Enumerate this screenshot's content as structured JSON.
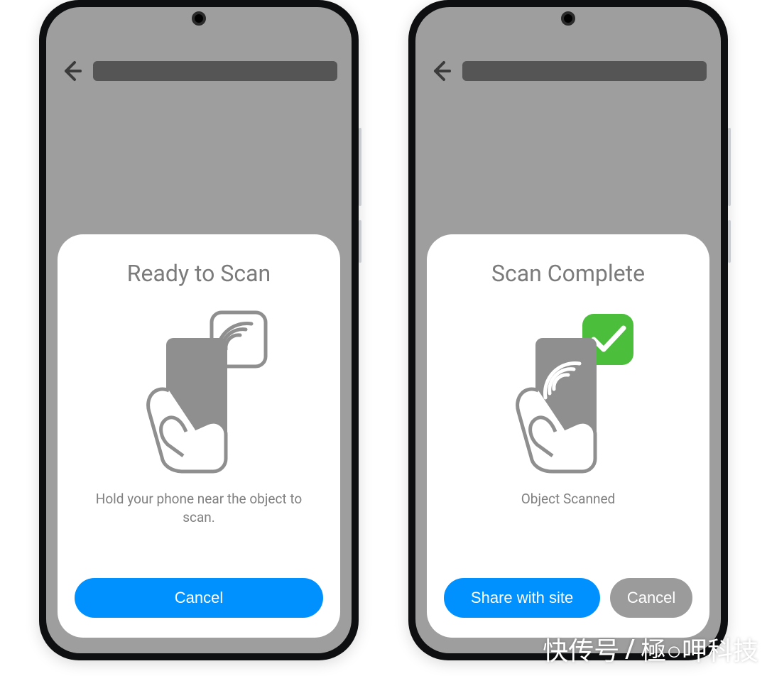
{
  "left": {
    "sheet_title": "Ready to Scan",
    "subtitle": "Hold your phone near the object to scan.",
    "cancel_label": "Cancel"
  },
  "right": {
    "sheet_title": "Scan Complete",
    "subtitle": "Object Scanned",
    "share_label": "Share with site",
    "cancel_label": "Cancel"
  },
  "colors": {
    "primary": "#0091ff",
    "success": "#4bbf3b",
    "neutral": "#9e9e9e"
  },
  "watermark": {
    "left": "快传号",
    "sep": "/",
    "right": "極○呷科技"
  }
}
